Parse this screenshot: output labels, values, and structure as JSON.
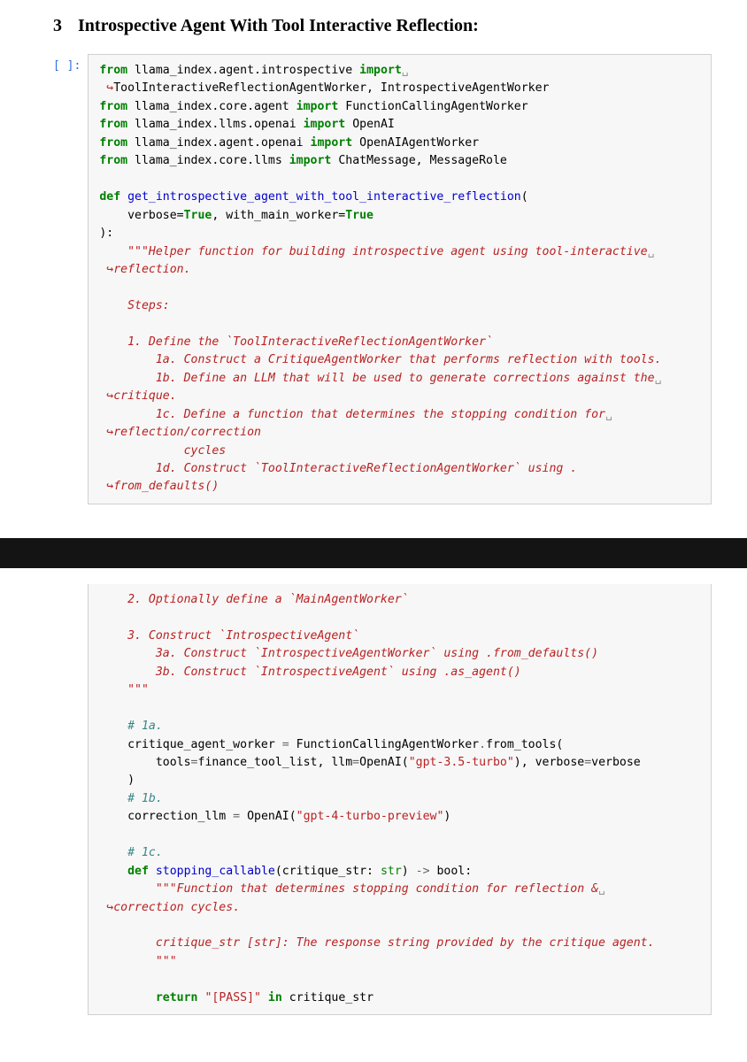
{
  "heading": {
    "number": "3",
    "title": "Introspective Agent With Tool Interactive Reflection:"
  },
  "prompt": "[ ]:",
  "tokens": {
    "from": "from",
    "import": "import",
    "def": "def",
    "return": "return",
    "in": "in",
    "true": "True",
    "mod1": "llama_index.agent.introspective",
    "imp1a": "ToolInteractiveReflectionAgentWorker, IntrospectiveAgentWorker",
    "mod2": "llama_index.core.agent",
    "imp2": "FunctionCallingAgentWorker",
    "mod3": "llama_index.llms.openai",
    "imp3": "OpenAI",
    "mod4": "llama_index.agent.openai",
    "imp4": "OpenAIAgentWorker",
    "mod5": "llama_index.core.llms",
    "imp5": "ChatMessage, MessageRole",
    "fnname": "get_introspective_agent_with_tool_interactive_reflection",
    "params": "verbose=",
    "params2": ", with_main_worker=",
    "doc1": "\"\"\"Helper function for building introspective agent using tool-interactive",
    "doc1b": "reflection.",
    "docSteps": "Steps:",
    "doc2": "1. Define the `ToolInteractiveReflectionAgentWorker`",
    "doc2a": "1a. Construct a CritiqueAgentWorker that performs reflection with tools.",
    "doc2b": "1b. Define an LLM that will be used to generate corrections against the",
    "doc2b2": "critique.",
    "doc2c": "1c. Define a function that determines the stopping condition for",
    "doc2c2": "reflection/correction",
    "doc2c3": "cycles",
    "doc2d": "1d. Construct `ToolInteractiveReflectionAgentWorker` using .",
    "doc2d2": "from_defaults()",
    "doc3": "2. Optionally define a `MainAgentWorker`",
    "doc4": "3. Construct `IntrospectiveAgent`",
    "doc4a": "3a. Construct `IntrospectiveAgentWorker` using .from_defaults()",
    "doc4b": "3b. Construct `IntrospectiveAgent` using .as_agent()",
    "docend": "\"\"\"",
    "c1a": "# 1a.",
    "line1": "critique_agent_worker ",
    "line1b": " FunctionCallingAgentWorker",
    "line1c": "from_tools(",
    "line2a": "tools",
    "line2b": "finance_tool_list, llm",
    "line2c": "OpenAI(",
    "str_gpt35": "\"gpt-3.5-turbo\"",
    "line2d": "), verbose",
    "line2e": "verbose",
    "c1b": "# 1b.",
    "line3a": "correction_llm ",
    "line3b": " OpenAI(",
    "str_gpt4": "\"gpt-4-turbo-preview\"",
    "c1c": "# 1c.",
    "fn2": "stopping_callable",
    "fn2p": "(critique_str: ",
    "fn2t": "str",
    "fn2a": ") ",
    "fn2r": "->",
    "fn2b": " bool:",
    "doc5": "\"\"\"Function that determines stopping condition for reflection &",
    "doc5b": "correction cycles.",
    "doc6": "critique_str [str]: The response string provided by the critique agent.",
    "str_pass": "\"[PASS]\"",
    "ret2": " critique_str",
    "eq": "=",
    "dot": ".",
    "contmark": "↪",
    "softwrap": "␣"
  }
}
